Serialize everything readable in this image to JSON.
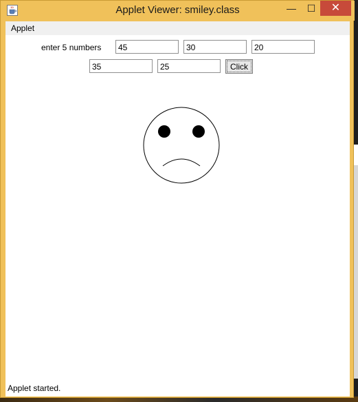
{
  "window": {
    "title": "Applet Viewer: smiley.class",
    "minimize_glyph": "—",
    "maximize_glyph": "☐",
    "close_glyph": "✕"
  },
  "menubar": {
    "items": [
      {
        "label": "Applet"
      }
    ]
  },
  "applet": {
    "prompt_label": "enter 5 numbers",
    "inputs": [
      {
        "value": "45"
      },
      {
        "value": "30"
      },
      {
        "value": "20"
      },
      {
        "value": "35"
      },
      {
        "value": "25"
      }
    ],
    "click_label": "Click",
    "face": {
      "mood": "sad",
      "outline_color": "#000000",
      "eye_color": "#000000"
    }
  },
  "status": {
    "text": "Applet started."
  },
  "colors": {
    "titlebar": "#f0c15a",
    "close_button": "#c74a3a",
    "client_bg": "#ffffff",
    "menubar_bg": "#f0f0f0"
  },
  "icons": {
    "app_icon": "java-cup-icon"
  }
}
